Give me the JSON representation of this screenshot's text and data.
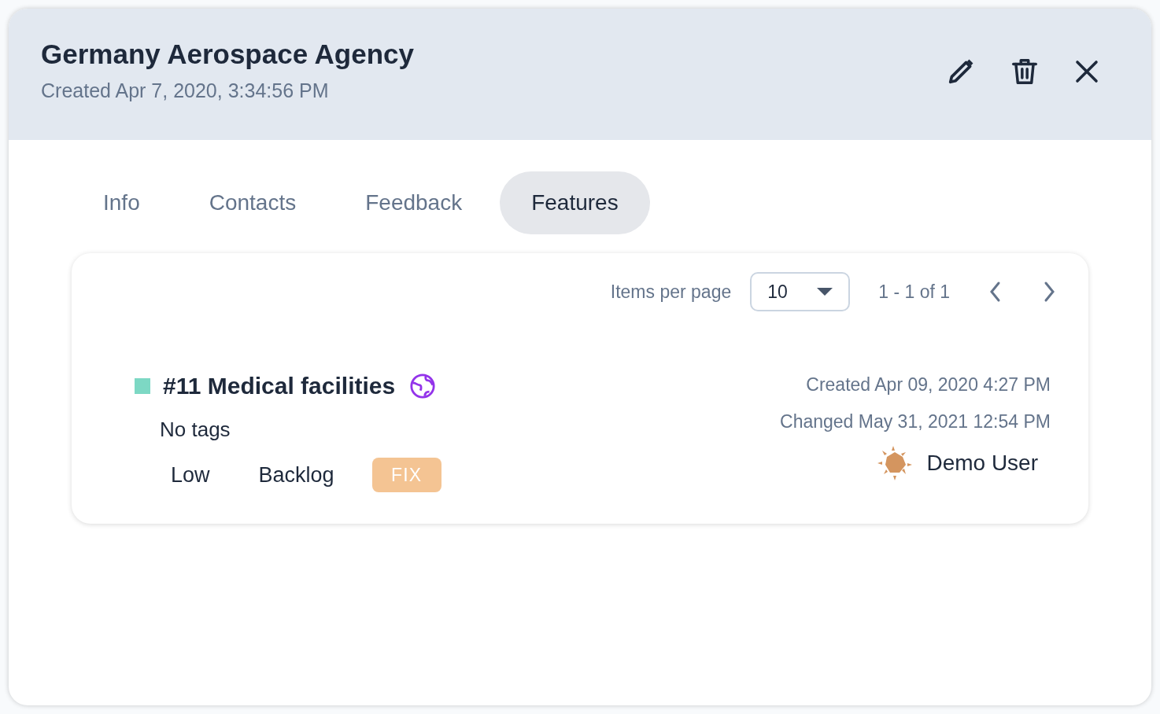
{
  "header": {
    "title": "Germany Aerospace Agency",
    "subtitle": "Created Apr 7, 2020, 3:34:56 PM"
  },
  "tabs": [
    {
      "label": "Info",
      "selected": false
    },
    {
      "label": "Contacts",
      "selected": false
    },
    {
      "label": "Feedback",
      "selected": false
    },
    {
      "label": "Features",
      "selected": true
    }
  ],
  "pagination": {
    "label": "Items per page",
    "page_size": "10",
    "range": "1 - 1 of 1"
  },
  "features": [
    {
      "color": "#7dd8c4",
      "title": "#11 Medical facilities",
      "tags": "No tags",
      "priority": "Low",
      "status": "Backlog",
      "type": "FIX",
      "created": "Created Apr 09, 2020 4:27 PM",
      "changed": "Changed May 31, 2021 12:54 PM",
      "user": "Demo User"
    }
  ]
}
